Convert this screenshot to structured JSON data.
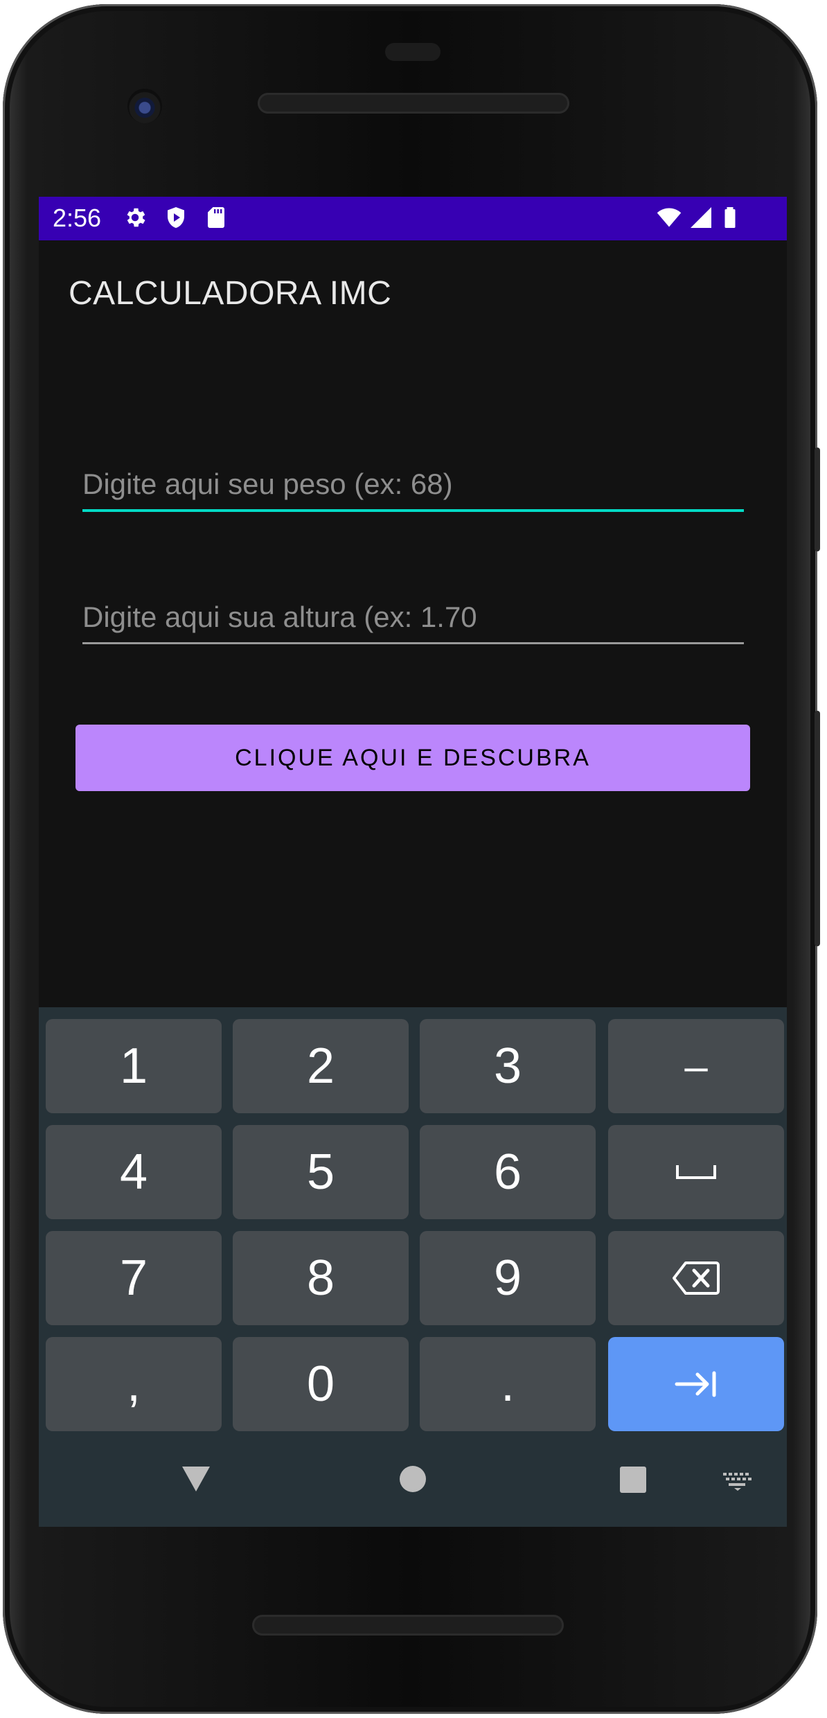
{
  "status_bar": {
    "time": "2:56",
    "left_icons": [
      "settings-icon",
      "shield-icon",
      "sd-card-icon"
    ],
    "right_icons": [
      "wifi-icon",
      "cell-signal-icon",
      "battery-icon"
    ],
    "color": "#3700b3"
  },
  "app": {
    "title": "CALCULADORA IMC",
    "peso_field": {
      "value": "",
      "placeholder": "Digite aqui seu peso (ex: 68)"
    },
    "altura_field": {
      "value": "",
      "placeholder": "Digite aqui sua altura (ex: 1.70"
    },
    "button_label": "CLIQUE AQUI E DESCUBRA",
    "accent": "#bb86fc",
    "focus_color": "#03dac5"
  },
  "keyboard": {
    "row1": [
      "1",
      "2",
      "3",
      "–"
    ],
    "row2": [
      "4",
      "5",
      "6",
      "␣"
    ],
    "row3": [
      "7",
      "8",
      "9",
      "⌫"
    ],
    "row4": [
      ",",
      "0",
      ".",
      "⇥"
    ]
  },
  "nav_bar": {
    "icons": [
      "back-icon",
      "home-icon",
      "recents-icon",
      "keyboard-switch-icon"
    ]
  }
}
